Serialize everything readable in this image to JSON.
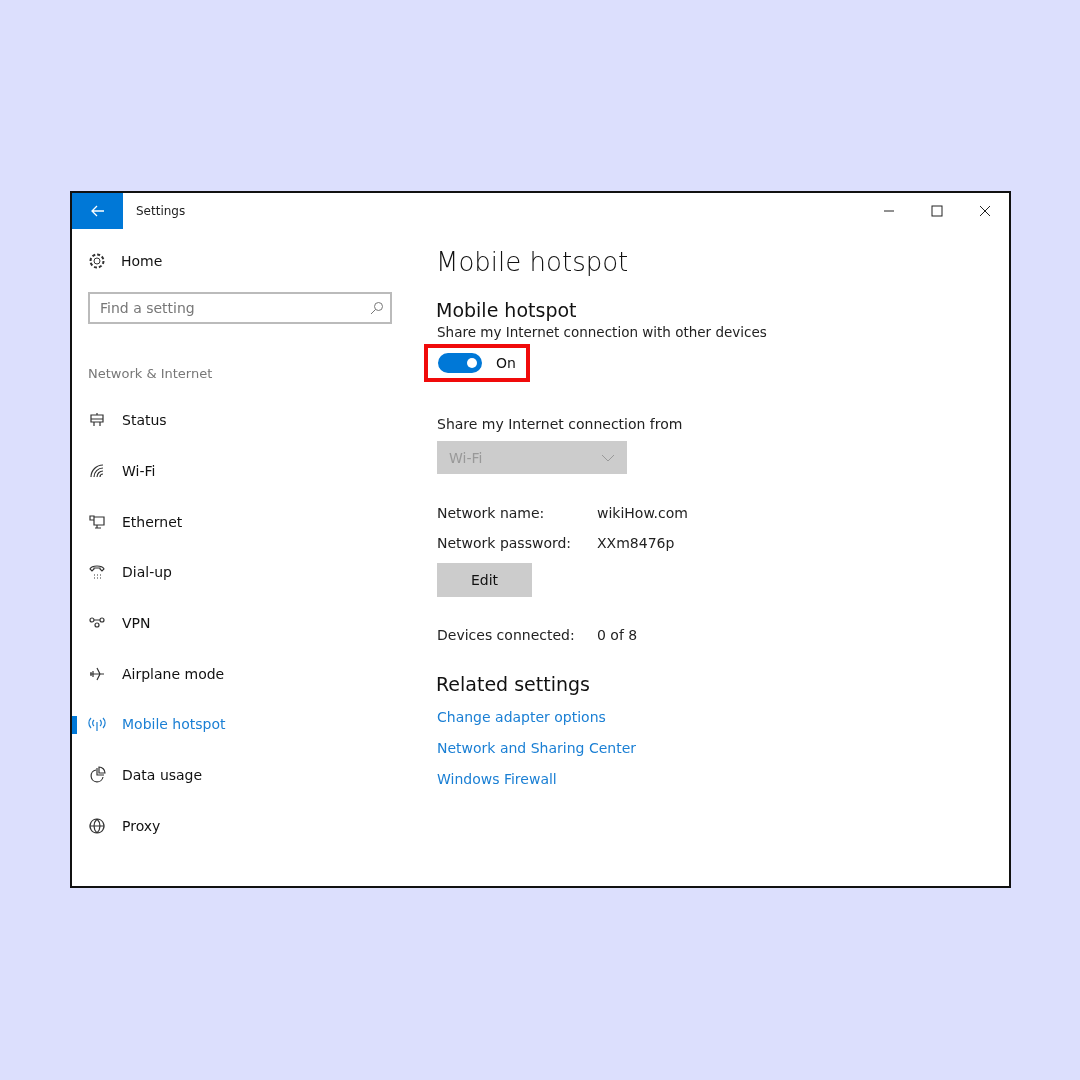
{
  "window": {
    "title": "Settings"
  },
  "sidebar": {
    "home": "Home",
    "search": {
      "placeholder": "Find a setting"
    },
    "section": "Network & Internet",
    "items": [
      {
        "label": "Status",
        "selected": false
      },
      {
        "label": "Wi-Fi",
        "selected": false
      },
      {
        "label": "Ethernet",
        "selected": false
      },
      {
        "label": "Dial-up",
        "selected": false
      },
      {
        "label": "VPN",
        "selected": false
      },
      {
        "label": "Airplane mode",
        "selected": false
      },
      {
        "label": "Mobile hotspot",
        "selected": true
      },
      {
        "label": "Data usage",
        "selected": false
      },
      {
        "label": "Proxy",
        "selected": false
      }
    ]
  },
  "page": {
    "title": "Mobile hotspot",
    "heading": "Mobile hotspot",
    "description": "Share my Internet connection with other devices",
    "toggle": {
      "on": true,
      "label": "On",
      "highlighted": true
    },
    "share_from": {
      "label": "Share my Internet connection from",
      "value": "Wi-Fi",
      "disabled": true
    },
    "details": [
      {
        "label": "Network name:",
        "value": "wikiHow.com"
      },
      {
        "label": "Network password:",
        "value": "XXm8476p"
      }
    ],
    "edit_button": "Edit",
    "devices": {
      "label": "Devices connected:",
      "value": "0 of 8"
    },
    "related_heading": "Related settings",
    "related_links": [
      "Change adapter options",
      "Network and Sharing Center",
      "Windows Firewall"
    ]
  }
}
